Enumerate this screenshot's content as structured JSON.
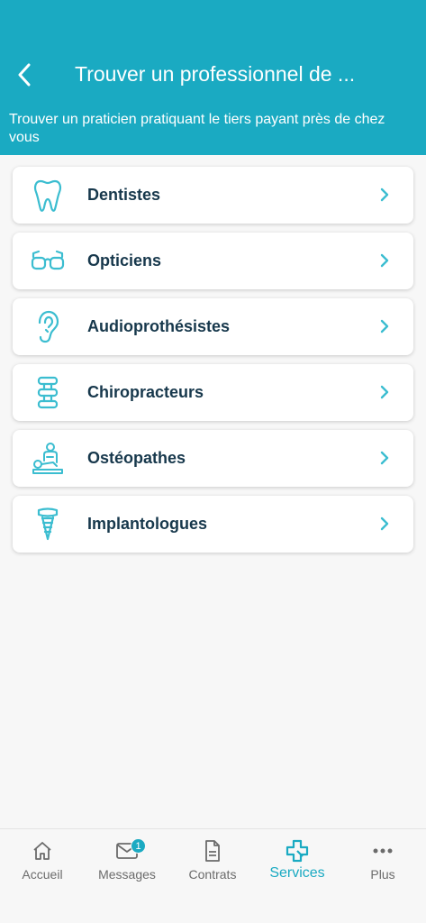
{
  "header": {
    "title": "Trouver un professionnel de ...",
    "subtitle": "Trouver un praticien pratiquant le tiers payant près de chez vous"
  },
  "items": [
    {
      "label": "Dentistes",
      "icon": "tooth-icon"
    },
    {
      "label": "Opticiens",
      "icon": "glasses-icon"
    },
    {
      "label": "Audioprothésistes",
      "icon": "ear-icon"
    },
    {
      "label": "Chiropracteurs",
      "icon": "spine-icon"
    },
    {
      "label": "Ostéopathes",
      "icon": "osteopath-icon"
    },
    {
      "label": "Implantologues",
      "icon": "dental-implant-icon"
    }
  ],
  "tabbar": {
    "tabs": [
      {
        "label": "Accueil",
        "icon": "home-icon"
      },
      {
        "label": "Messages",
        "icon": "mail-icon",
        "badge": "1"
      },
      {
        "label": "Contrats",
        "icon": "document-icon"
      },
      {
        "label": "Services",
        "icon": "medical-cross-icon",
        "active": true
      },
      {
        "label": "Plus",
        "icon": "more-icon"
      }
    ]
  },
  "colors": {
    "accent": "#1aaac2",
    "text_dark": "#17384c",
    "background": "#f7f7f7"
  }
}
